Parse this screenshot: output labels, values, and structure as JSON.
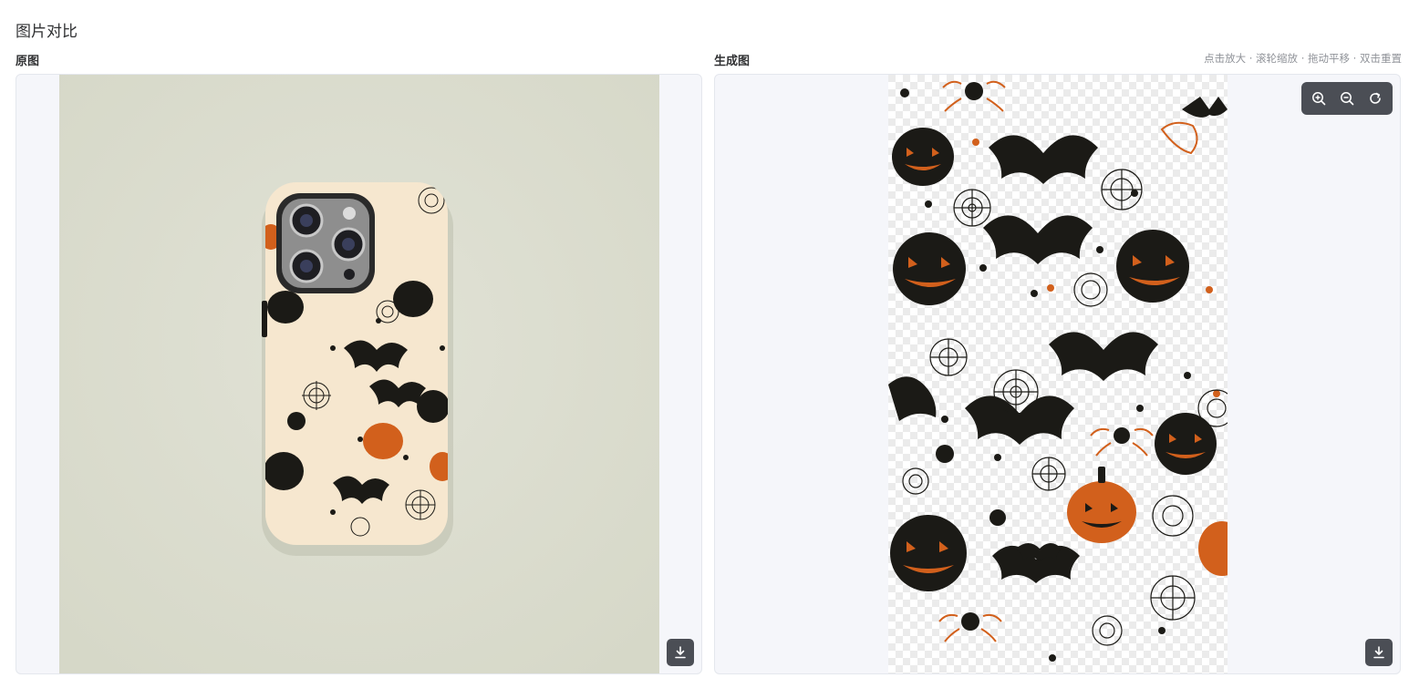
{
  "page": {
    "title": "图片对比"
  },
  "left": {
    "label": "原图",
    "download_icon": "download-icon"
  },
  "right": {
    "label": "生成图",
    "hint": "点击放大 · 滚轮缩放 · 拖动平移 · 双击重置",
    "zoom_controls": [
      "zoom-in-icon",
      "zoom-out-icon",
      "reset-icon"
    ],
    "download_icon": "download-icon"
  },
  "colors": {
    "background_original": "#dcdecf",
    "case_color": "#f6e7cf",
    "pumpkin": "#d2601c",
    "ink": "#1b1a16",
    "toolbar": "#4b4e55"
  }
}
